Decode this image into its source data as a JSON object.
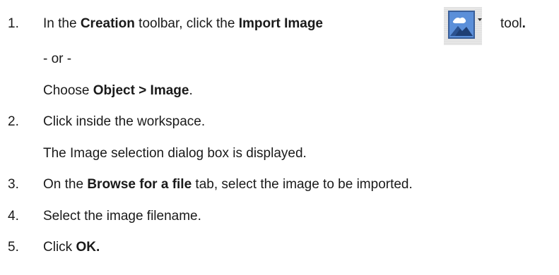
{
  "steps": [
    {
      "number": "1.",
      "parts": [
        {
          "text": "In the ",
          "bold": false
        },
        {
          "text": "Creation",
          "bold": true
        },
        {
          "text": " toolbar, click the ",
          "bold": false
        },
        {
          "text": "Import Image",
          "bold": true
        }
      ],
      "after_icon": {
        "text": "tool",
        "bold_punct": "."
      },
      "or_text": "- or -",
      "alt_parts": [
        {
          "text": "Choose ",
          "bold": false
        },
        {
          "text": "Object > Image",
          "bold": true
        },
        {
          "text": ".",
          "bold": false
        }
      ]
    },
    {
      "number": "2.",
      "text": "Click inside the workspace.",
      "sub_text": "The Image selection dialog box is displayed."
    },
    {
      "number": "3.",
      "parts": [
        {
          "text": "On the ",
          "bold": false
        },
        {
          "text": "Browse for a file",
          "bold": true
        },
        {
          "text": " tab, select the image to be imported.",
          "bold": false
        }
      ]
    },
    {
      "number": "4.",
      "text": "Select the image filename."
    },
    {
      "number": "5.",
      "parts": [
        {
          "text": "Click ",
          "bold": false
        },
        {
          "text": "OK.",
          "bold": true
        }
      ]
    }
  ],
  "icon": {
    "name": "import-image-icon",
    "frame_color": "#3a5f99",
    "fill_color": "#4a7fd1"
  }
}
